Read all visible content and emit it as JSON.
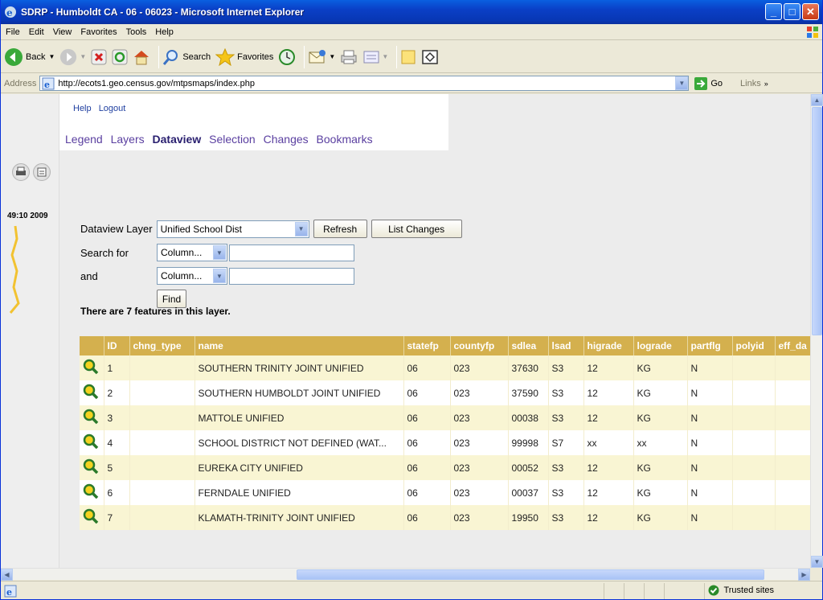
{
  "window": {
    "title": "SDRP - Humboldt CA - 06 - 06023 - Microsoft Internet Explorer",
    "min": "_",
    "max": "□",
    "close": "✕"
  },
  "menu": [
    "File",
    "Edit",
    "View",
    "Favorites",
    "Tools",
    "Help"
  ],
  "toolbar": {
    "back": "Back",
    "search": "Search",
    "favorites": "Favorites"
  },
  "address": {
    "label": "Address",
    "url": "http://ecots1.geo.census.gov/mtpsmaps/index.php",
    "go": "Go",
    "links": "Links"
  },
  "nav": {
    "help": "Help",
    "logout": "Logout",
    "tabs": [
      "Legend",
      "Layers",
      "Dataview",
      "Selection",
      "Changes",
      "Bookmarks"
    ],
    "active_tab": "Dataview"
  },
  "timestamp": "49:10 2009",
  "dataview": {
    "layer_label": "Dataview Layer",
    "layer_value": "Unified School Dist",
    "refresh": "Refresh",
    "list_changes": "List Changes",
    "search_label": "Search for",
    "and_label": "and",
    "column_placeholder": "Column...",
    "find": "Find",
    "summary": "There are 7 features in this layer."
  },
  "table": {
    "headers": [
      "",
      "ID",
      "chng_type",
      "name",
      "statefp",
      "countyfp",
      "sdlea",
      "lsad",
      "higrade",
      "lograde",
      "partflg",
      "polyid",
      "eff_da"
    ],
    "rows": [
      [
        "1",
        "",
        "SOUTHERN TRINITY JOINT UNIFIED",
        "06",
        "023",
        "37630",
        "S3",
        "12",
        "KG",
        "N"
      ],
      [
        "2",
        "",
        "SOUTHERN HUMBOLDT JOINT UNIFIED",
        "06",
        "023",
        "37590",
        "S3",
        "12",
        "KG",
        "N"
      ],
      [
        "3",
        "",
        "MATTOLE UNIFIED",
        "06",
        "023",
        "00038",
        "S3",
        "12",
        "KG",
        "N"
      ],
      [
        "4",
        "",
        "SCHOOL DISTRICT NOT DEFINED (WAT...",
        "06",
        "023",
        "99998",
        "S7",
        "xx",
        "xx",
        "N"
      ],
      [
        "5",
        "",
        "EUREKA CITY UNIFIED",
        "06",
        "023",
        "00052",
        "S3",
        "12",
        "KG",
        "N"
      ],
      [
        "6",
        "",
        "FERNDALE UNIFIED",
        "06",
        "023",
        "00037",
        "S3",
        "12",
        "KG",
        "N"
      ],
      [
        "7",
        "",
        "KLAMATH-TRINITY JOINT UNIFIED",
        "06",
        "023",
        "19950",
        "S3",
        "12",
        "KG",
        "N"
      ]
    ]
  },
  "status": {
    "zone": "Trusted sites"
  },
  "colors": {
    "title_bar": "#0a3fc6",
    "header_row": "#d4b04e",
    "odd_row": "#f9f5d3",
    "active_tab": "#2a2070"
  }
}
